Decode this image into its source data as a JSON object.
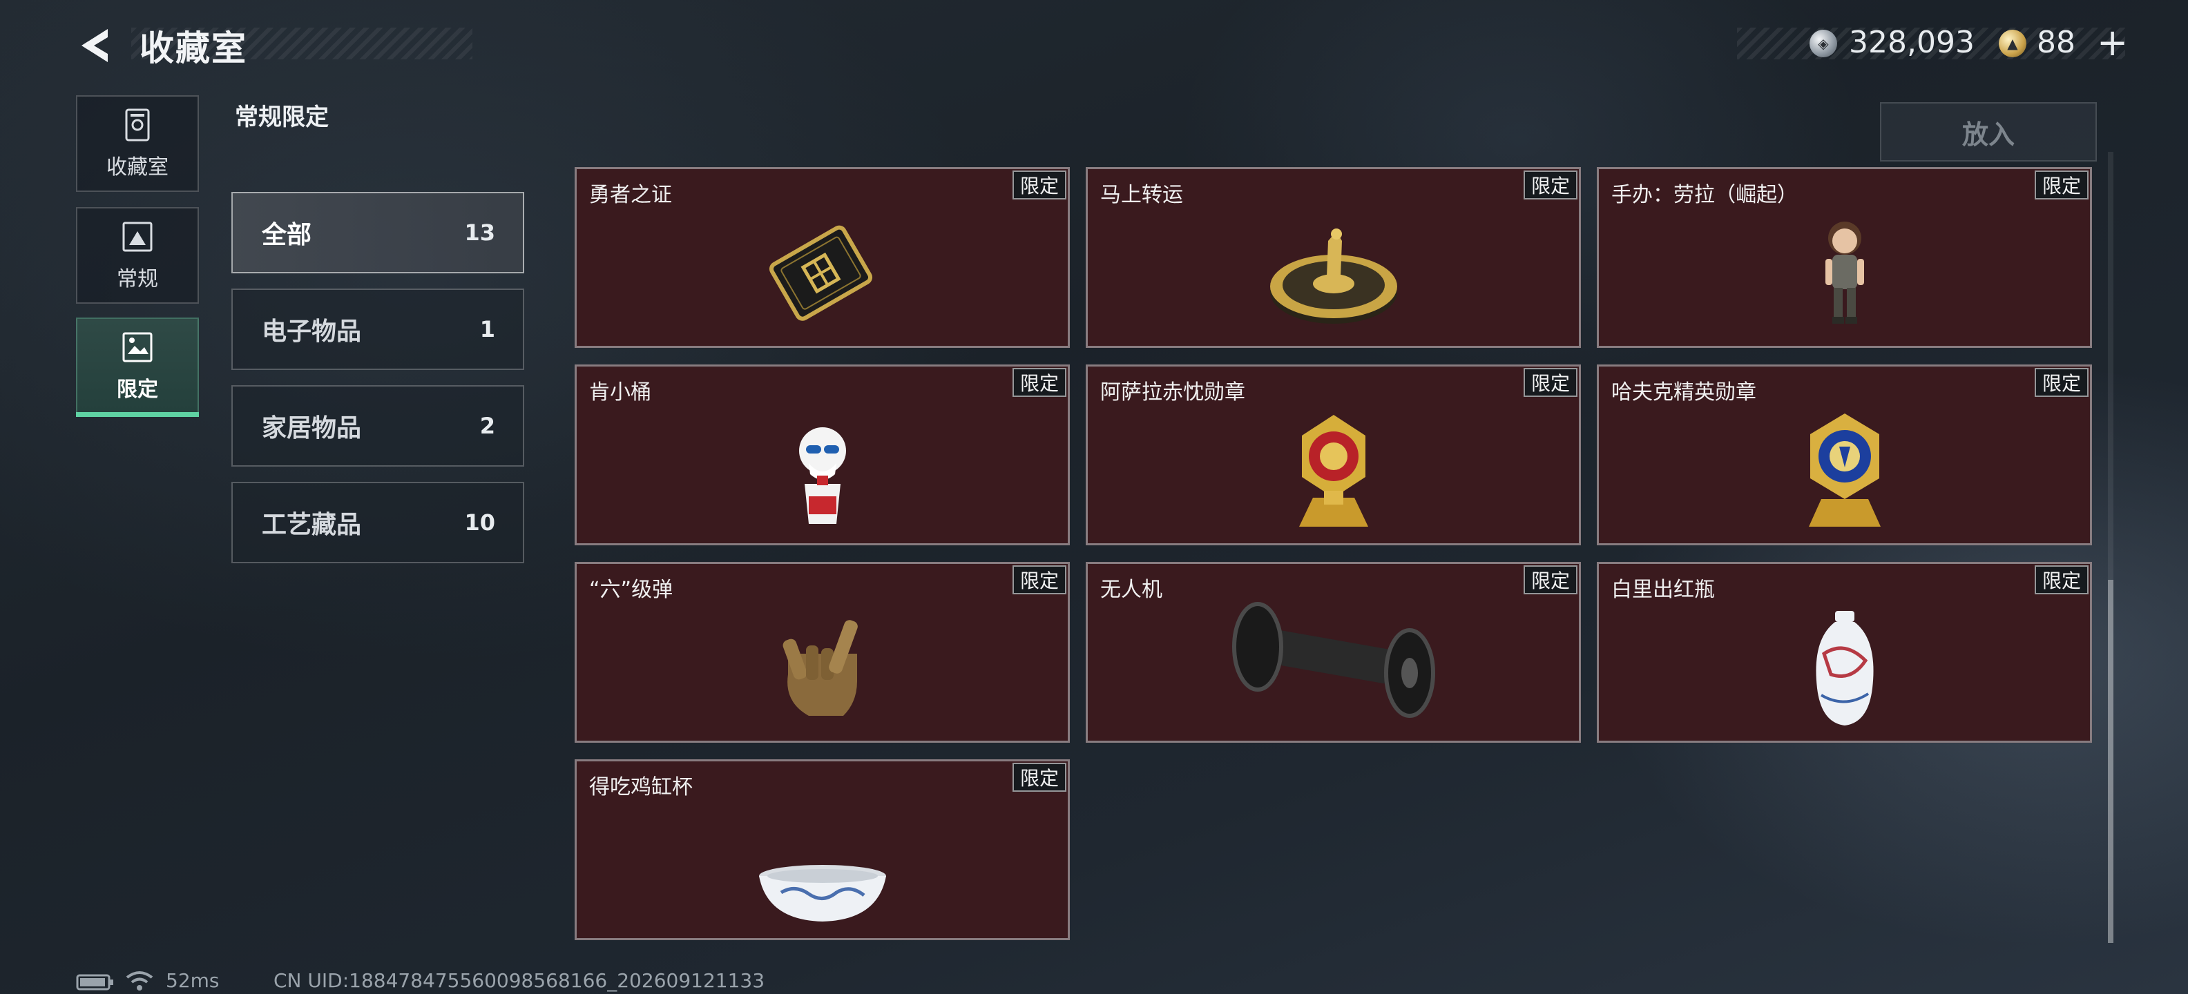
{
  "header": {
    "title": "收藏室",
    "currency": {
      "silver": "328,093",
      "gold": "88"
    },
    "plus_label": "+"
  },
  "nav": {
    "items": [
      {
        "label": "收藏室",
        "icon": "vault-icon",
        "active": false
      },
      {
        "label": "常规",
        "icon": "picture-icon",
        "active": false
      },
      {
        "label": "限定",
        "icon": "limited-picture-icon",
        "active": true
      }
    ]
  },
  "section_title": "常规限定",
  "put_in_label": "放入",
  "categories": [
    {
      "name": "全部",
      "count": "13",
      "active": true
    },
    {
      "name": "电子物品",
      "count": "1",
      "active": false
    },
    {
      "name": "家居物品",
      "count": "2",
      "active": false
    },
    {
      "name": "工艺藏品",
      "count": "10",
      "active": false
    }
  ],
  "items": [
    {
      "name": "勇者之证",
      "tag": "限定",
      "icon": "brave-card-icon"
    },
    {
      "name": "马上转运",
      "tag": "限定",
      "icon": "horse-compass-icon"
    },
    {
      "name": "手办：劳拉（崛起）",
      "tag": "限定",
      "icon": "lara-figure-icon"
    },
    {
      "name": "肯小桶",
      "tag": "限定",
      "icon": "colonel-bucket-icon"
    },
    {
      "name": "阿萨拉赤忱勋章",
      "tag": "限定",
      "icon": "red-medal-icon"
    },
    {
      "name": "哈夫克精英勋章",
      "tag": "限定",
      "icon": "blue-medal-icon"
    },
    {
      "name": "“六”级弹",
      "tag": "限定",
      "icon": "six-bullet-hand-icon"
    },
    {
      "name": "无人机",
      "tag": "限定",
      "icon": "drone-icon"
    },
    {
      "name": "白里出红瓶",
      "tag": "限定",
      "icon": "porcelain-vase-icon"
    },
    {
      "name": "得吃鸡缸杯",
      "tag": "限定",
      "icon": "chicken-cup-icon"
    }
  ],
  "status": {
    "ping": "52ms",
    "uid": "CN UID:18847847556009856816​6_202609121133"
  }
}
